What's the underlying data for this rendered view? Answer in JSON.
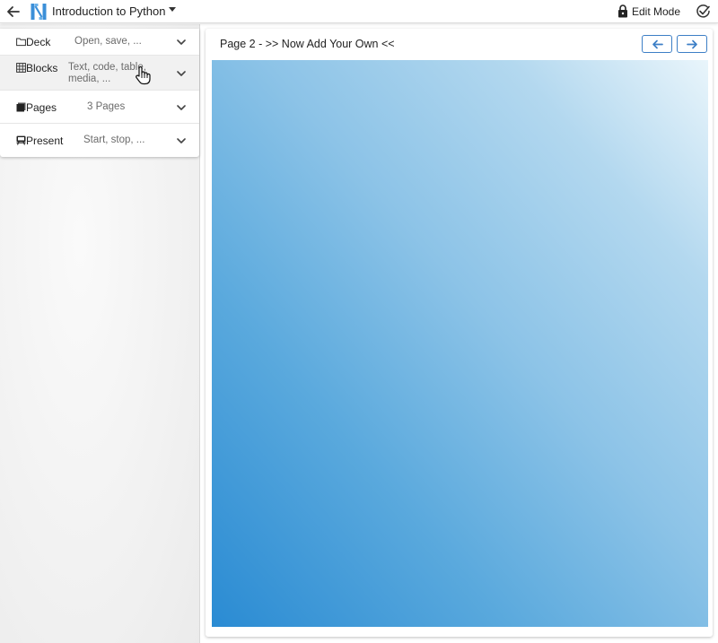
{
  "header": {
    "title": "Introduction to Python",
    "edit_mode_label": "Edit Mode",
    "icons": [
      "back-arrow-icon",
      "app-logo-icon",
      "caret-down-icon",
      "lock-icon",
      "check-circle-icon"
    ]
  },
  "sidebar": {
    "items": [
      {
        "label": "Deck",
        "sub": "Open, save, ...",
        "icon": "folder-icon"
      },
      {
        "label": "Blocks",
        "sub_line1": "Text, code, table,",
        "sub_line2": "media, ...",
        "icon": "grid-icon"
      },
      {
        "label": "Pages",
        "sub": "3 Pages",
        "icon": "pages-icon"
      },
      {
        "label": "Present",
        "sub": "Start, stop, ...",
        "icon": "presentation-icon"
      }
    ]
  },
  "page": {
    "title": "Page 2 -  >> Now Add Your Own <<"
  },
  "colors": {
    "accent": "#3d7fc6",
    "slide_gradient_start": "#2a8bd3",
    "slide_gradient_end": "#e9f5fb"
  }
}
